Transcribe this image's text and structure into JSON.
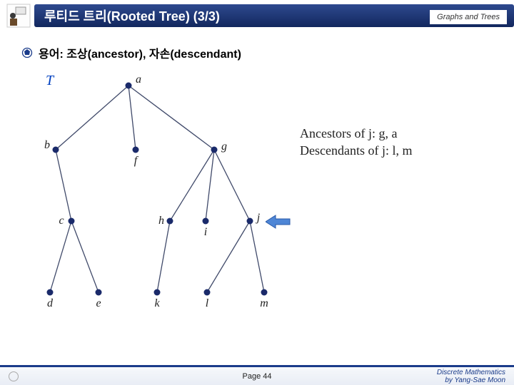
{
  "header": {
    "title": "루티드 트리(Rooted Tree) (3/3)",
    "section": "Graphs and Trees"
  },
  "subheading": "용어: 조상(ancestor), 자손(descendant)",
  "tree": {
    "label_T": "T",
    "nodes": {
      "a": "a",
      "b": "b",
      "c": "c",
      "d": "d",
      "e": "e",
      "f": "f",
      "g": "g",
      "h": "h",
      "i": "i",
      "j": "j",
      "k": "k",
      "l": "l",
      "m": "m"
    }
  },
  "annotations": {
    "line1": "Ancestors of j: g, a",
    "line2": "Descendants of j: l, m"
  },
  "footer": {
    "page": "Page 44",
    "course": "Discrete Mathematics",
    "author": "by Yang-Sae Moon"
  }
}
